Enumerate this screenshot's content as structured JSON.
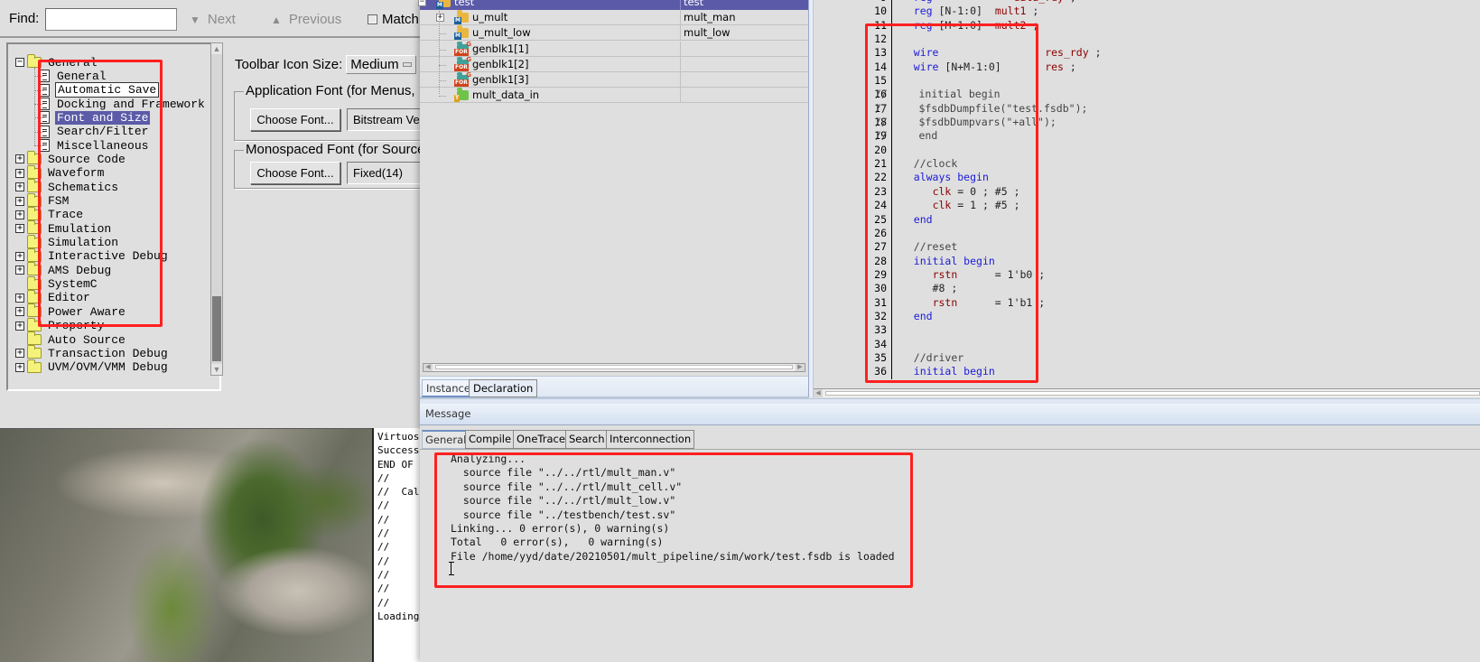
{
  "preferences": {
    "findbar": {
      "find_label": "Find:",
      "find_value": "",
      "next_label": "Next",
      "previous_label": "Previous",
      "match_case_label": "Match Ca",
      "match_case_checked": false
    },
    "tree": {
      "items": [
        {
          "label": "General",
          "level": 0,
          "expander": "minus",
          "type": "folder"
        },
        {
          "label": "General",
          "level": 1,
          "type": "page"
        },
        {
          "label": "Automatic Save",
          "level": 1,
          "type": "page",
          "focused": true
        },
        {
          "label": "Docking and Framework",
          "level": 1,
          "type": "page"
        },
        {
          "label": "Font and Size",
          "level": 1,
          "type": "page",
          "selected": true
        },
        {
          "label": "Search/Filter",
          "level": 1,
          "type": "page"
        },
        {
          "label": "Miscellaneous",
          "level": 1,
          "type": "page"
        },
        {
          "label": "Source Code",
          "level": 0,
          "expander": "plus",
          "type": "folder"
        },
        {
          "label": "Waveform",
          "level": 0,
          "expander": "plus",
          "type": "folder"
        },
        {
          "label": "Schematics",
          "level": 0,
          "expander": "plus",
          "type": "folder"
        },
        {
          "label": "FSM",
          "level": 0,
          "expander": "plus",
          "type": "folder"
        },
        {
          "label": "Trace",
          "level": 0,
          "expander": "plus",
          "type": "folder"
        },
        {
          "label": "Emulation",
          "level": 0,
          "expander": "plus",
          "type": "folder"
        },
        {
          "label": "Simulation",
          "level": 0,
          "expander": "none",
          "type": "folder"
        },
        {
          "label": "Interactive Debug",
          "level": 0,
          "expander": "plus",
          "type": "folder"
        },
        {
          "label": "AMS Debug",
          "level": 0,
          "expander": "plus",
          "type": "folder"
        },
        {
          "label": "SystemC",
          "level": 0,
          "expander": "none",
          "type": "folder"
        },
        {
          "label": "Editor",
          "level": 0,
          "expander": "plus",
          "type": "folder"
        },
        {
          "label": "Power Aware",
          "level": 0,
          "expander": "plus",
          "type": "folder"
        },
        {
          "label": "Property",
          "level": 0,
          "expander": "plus",
          "type": "folder"
        },
        {
          "label": "Auto Source",
          "level": 0,
          "expander": "none",
          "type": "folder"
        },
        {
          "label": "Transaction Debug",
          "level": 0,
          "expander": "plus",
          "type": "folder"
        },
        {
          "label": "UVM/OVM/VMM Debug",
          "level": 0,
          "expander": "plus",
          "type": "folder"
        }
      ]
    },
    "toolbar_icon_size_label": "Toolbar Icon Size:",
    "toolbar_icon_size_value": "Medium",
    "app_font": {
      "legend": "Application Font (for Menus, Dia",
      "button": "Choose Font...",
      "value": "Bitstream Vera"
    },
    "mono_font": {
      "legend": "Monospaced Font (for Source, V",
      "button": "Choose Font...",
      "value": "Fixed(14)"
    }
  },
  "console_lines": [
    "Virtuoso",
    "Successf",
    "END OF S",
    "//",
    "//  Cali",
    "//",
    "//",
    "//",
    "//",
    "//",
    "//",
    "//",
    "//",
    "Loading"
  ],
  "hierarchy": {
    "rows": [
      {
        "name": "test",
        "module": "test",
        "icon": "module",
        "selected": true,
        "expander": "minus"
      },
      {
        "name": "u_mult",
        "module": "mult_man",
        "icon": "module",
        "expander": "plus"
      },
      {
        "name": "u_mult_low",
        "module": "mult_low",
        "icon": "module"
      },
      {
        "name": "genblk1[1]",
        "module": "",
        "icon": "generate-for"
      },
      {
        "name": "genblk1[2]",
        "module": "",
        "icon": "generate-for"
      },
      {
        "name": "genblk1[3]",
        "module": "",
        "icon": "generate-for"
      },
      {
        "name": "mult_data_in",
        "module": "",
        "icon": "task"
      }
    ],
    "tabs": [
      {
        "label": "Instance",
        "active": true
      },
      {
        "label": "Declaration",
        "active": false
      }
    ]
  },
  "source": {
    "lines": [
      {
        "n": "9",
        "tokens": [
          {
            "t": "reg",
            "c": "kw"
          },
          {
            "t": "             ",
            "c": "pl"
          },
          {
            "t": "data_rdy",
            "c": "sig"
          },
          {
            "t": " ;",
            "c": "pl"
          }
        ]
      },
      {
        "n": "10",
        "tokens": [
          {
            "t": "reg",
            "c": "kw"
          },
          {
            "t": " [N-1:0]  ",
            "c": "pl"
          },
          {
            "t": "mult1",
            "c": "sig"
          },
          {
            "t": " ;",
            "c": "pl"
          }
        ]
      },
      {
        "n": "11",
        "tokens": [
          {
            "t": "reg",
            "c": "kw"
          },
          {
            "t": " [M-1:0]  ",
            "c": "pl"
          },
          {
            "t": "mult2",
            "c": "sig"
          },
          {
            "t": " ;",
            "c": "pl"
          }
        ]
      },
      {
        "n": "12",
        "tokens": []
      },
      {
        "n": "13",
        "tokens": [
          {
            "t": "wire",
            "c": "kw"
          },
          {
            "t": "                 ",
            "c": "pl"
          },
          {
            "t": "res_rdy",
            "c": "sig"
          },
          {
            "t": " ;",
            "c": "pl"
          }
        ]
      },
      {
        "n": "14",
        "tokens": [
          {
            "t": "wire",
            "c": "kw"
          },
          {
            "t": " [N+M-1:0]       ",
            "c": "pl"
          },
          {
            "t": "res",
            "c": "sig"
          },
          {
            "t": " ;",
            "c": "pl"
          }
        ]
      },
      {
        "n": "15",
        "tokens": []
      },
      {
        "n": "16",
        "prefix": "//",
        "tokens": [
          {
            "t": "   initial begin",
            "c": "cm"
          }
        ]
      },
      {
        "n": "17",
        "prefix": "//",
        "tokens": [
          {
            "t": "   $fsdbDumpfile(\"test.fsdb\");",
            "c": "cm"
          }
        ]
      },
      {
        "n": "18",
        "prefix": "//",
        "tokens": [
          {
            "t": "   $fsdbDumpvars(\"+all\");",
            "c": "cm"
          }
        ]
      },
      {
        "n": "19",
        "prefix": "//",
        "tokens": [
          {
            "t": "   end",
            "c": "cm"
          }
        ]
      },
      {
        "n": "20",
        "tokens": []
      },
      {
        "n": "21",
        "tokens": [
          {
            "t": "//clock",
            "c": "cm"
          }
        ]
      },
      {
        "n": "22",
        "tokens": [
          {
            "t": "always begin",
            "c": "kw"
          }
        ]
      },
      {
        "n": "23",
        "tokens": [
          {
            "t": "   ",
            "c": "pl"
          },
          {
            "t": "clk",
            "c": "sig"
          },
          {
            "t": " = 0 ; #5 ;",
            "c": "pl"
          }
        ]
      },
      {
        "n": "24",
        "tokens": [
          {
            "t": "   ",
            "c": "pl"
          },
          {
            "t": "clk",
            "c": "sig"
          },
          {
            "t": " = 1 ; #5 ;",
            "c": "pl"
          }
        ]
      },
      {
        "n": "25",
        "tokens": [
          {
            "t": "end",
            "c": "kw"
          }
        ]
      },
      {
        "n": "26",
        "tokens": []
      },
      {
        "n": "27",
        "tokens": [
          {
            "t": "//reset",
            "c": "cm"
          }
        ]
      },
      {
        "n": "28",
        "tokens": [
          {
            "t": "initial begin",
            "c": "kw"
          }
        ]
      },
      {
        "n": "29",
        "tokens": [
          {
            "t": "   ",
            "c": "pl"
          },
          {
            "t": "rstn",
            "c": "sig"
          },
          {
            "t": "      = 1'b0 ;",
            "c": "pl"
          }
        ]
      },
      {
        "n": "30",
        "tokens": [
          {
            "t": "   #8 ;",
            "c": "pl"
          }
        ]
      },
      {
        "n": "31",
        "tokens": [
          {
            "t": "   ",
            "c": "pl"
          },
          {
            "t": "rstn",
            "c": "sig"
          },
          {
            "t": "      = 1'b1 ;",
            "c": "pl"
          }
        ]
      },
      {
        "n": "32",
        "tokens": [
          {
            "t": "end",
            "c": "kw"
          }
        ]
      },
      {
        "n": "33",
        "tokens": []
      },
      {
        "n": "34",
        "tokens": []
      },
      {
        "n": "35",
        "tokens": [
          {
            "t": "//driver",
            "c": "cm"
          }
        ]
      },
      {
        "n": "36",
        "tokens": [
          {
            "t": "initial begin",
            "c": "kw"
          }
        ]
      }
    ]
  },
  "message": {
    "title": "Message",
    "tabs": [
      {
        "label": "General",
        "active": true
      },
      {
        "label": "Compile",
        "active": false
      },
      {
        "label": "OneTrace",
        "active": false
      },
      {
        "label": "Search",
        "active": false
      },
      {
        "label": "Interconnection",
        "active": false
      }
    ],
    "lines": [
      "Analyzing...",
      "  source file \"../../rtl/mult_man.v\"",
      "  source file \"../../rtl/mult_cell.v\"",
      "  source file \"../../rtl/mult_low.v\"",
      "  source file \"../testbench/test.sv\"",
      "Linking... 0 error(s), 0 warning(s)",
      "Total   0 error(s),   0 warning(s)",
      "File /home/yyd/date/20210501/mult_pipeline/sim/work/test.fsdb is loaded"
    ]
  },
  "colors": {
    "selection": "#5b5aa8",
    "keyword": "#1a1ad8",
    "signal": "#8b0000",
    "annotation_red": "#ff2020",
    "folder_yellow": "#f4f27a"
  }
}
